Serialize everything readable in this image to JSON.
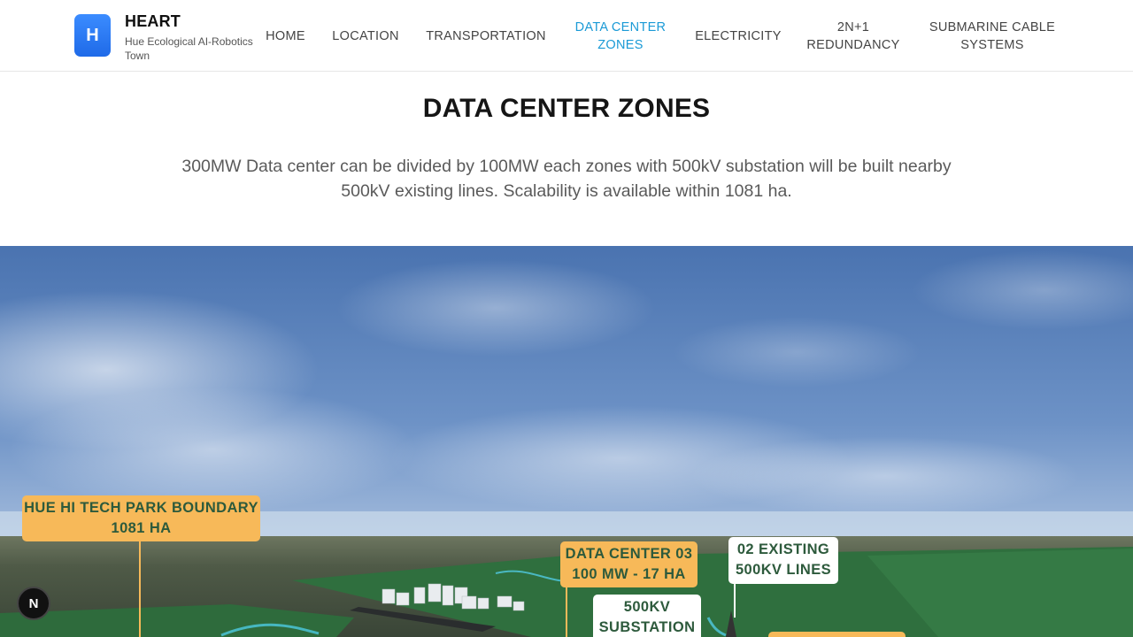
{
  "brand": {
    "logo_letter": "H",
    "title": "HEART",
    "subtitle": "Hue Ecological AI-Robotics Town"
  },
  "nav": {
    "items": [
      {
        "label": "HOME",
        "active": false
      },
      {
        "label": "LOCATION",
        "active": false
      },
      {
        "label": "TRANSPORTATION",
        "active": false
      },
      {
        "label": "DATA CENTER ZONES",
        "active": true
      },
      {
        "label": "ELECTRICITY",
        "active": false
      },
      {
        "label": "2N+1 REDUNDANCY",
        "active": false
      },
      {
        "label": "SUBMARINE CABLE SYSTEMS",
        "active": false
      }
    ],
    "active_color": "#1a9ad6"
  },
  "section": {
    "title": "DATA CENTER ZONES",
    "description": "300MW Data center can be divided by 100MW each zones with 500kV substation will be built nearby 500kV existing lines. Scalability is available within 1081 ha."
  },
  "scene": {
    "labels": {
      "boundary": "HUE HI TECH PARK BOUNDARY 1081 HA",
      "dc03": "DATA CENTER 03 100 MW - 17 HA",
      "lines": "02 EXISTING 500KV LINES",
      "substation": "500KV SUBSTATION"
    },
    "colors": {
      "label_orange": "#f7b959",
      "label_text": "#2d5a3c",
      "sky_top": "#4f78b5",
      "ground": "#2e6b3c"
    }
  },
  "fab": {
    "label": "N"
  }
}
